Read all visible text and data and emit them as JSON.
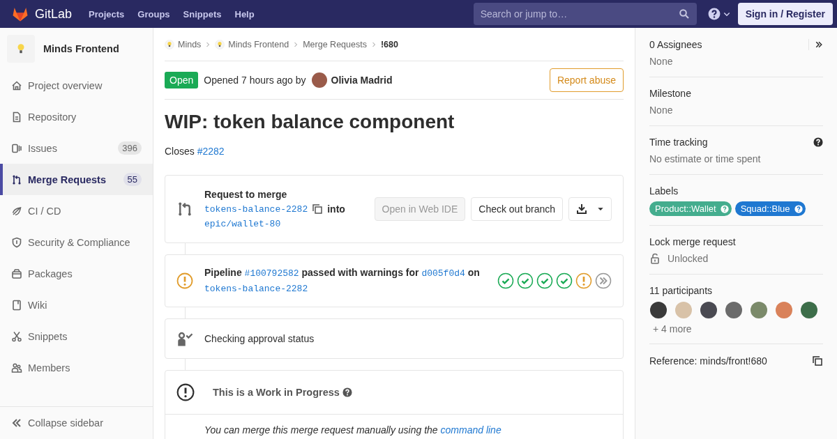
{
  "topbar": {
    "brand": "GitLab",
    "nav": [
      "Projects",
      "Groups",
      "Snippets",
      "Help"
    ],
    "search": {
      "placeholder": "Search or jump to…"
    },
    "sign_in": "Sign in / Register"
  },
  "sidebar": {
    "project": "Minds Frontend",
    "items": [
      {
        "label": "Project overview",
        "selected": false
      },
      {
        "label": "Repository",
        "selected": false
      },
      {
        "label": "Issues",
        "count": "396",
        "selected": false
      },
      {
        "label": "Merge Requests",
        "count": "55",
        "selected": true
      },
      {
        "label": "CI / CD",
        "selected": false
      },
      {
        "label": "Security & Compliance",
        "selected": false
      },
      {
        "label": "Packages",
        "selected": false
      },
      {
        "label": "Wiki",
        "selected": false
      },
      {
        "label": "Snippets",
        "selected": false
      },
      {
        "label": "Members",
        "selected": false
      }
    ],
    "collapse": "Collapse sidebar"
  },
  "breadcrumbs": [
    {
      "label": "Minds",
      "kind": "group"
    },
    {
      "label": "Minds Frontend",
      "kind": "group"
    },
    {
      "label": "Merge Requests",
      "kind": "link"
    },
    {
      "label": "!680",
      "kind": "current"
    }
  ],
  "header": {
    "status": "Open",
    "opened": "Opened 7 hours ago by",
    "author": "Olivia Madrid",
    "report": "Report abuse"
  },
  "title": "WIP: token balance component",
  "description": {
    "text": "Closes",
    "link": "#2282"
  },
  "merge_widget": {
    "heading": "Request to merge",
    "source": "tokens-balance-2282",
    "into": "into",
    "target": "epic/wallet-80",
    "buttons": [
      {
        "label": "Open in Web IDE",
        "disabled": true
      },
      {
        "label": "Check out branch",
        "disabled": false
      }
    ]
  },
  "pipeline": {
    "prefix": "Pipeline",
    "id": "#100792582",
    "status_text": "passed with warnings for",
    "commit": "d005f0d4",
    "on": "on",
    "branch": "tokens-balance-2282",
    "stages": [
      {
        "kind": "success"
      },
      {
        "kind": "success"
      },
      {
        "kind": "success"
      },
      {
        "kind": "success"
      },
      {
        "kind": "warning"
      }
    ]
  },
  "approval": "Checking approval status",
  "wip": {
    "heading": "This is a Work in Progress",
    "text": "You can merge this merge request manually using the",
    "link": "command line"
  },
  "right_sidebar": {
    "assignees": {
      "title": "0 Assignees",
      "value": "None"
    },
    "milestone": {
      "title": "Milestone",
      "value": "None"
    },
    "time_tracking": {
      "title": "Time tracking",
      "value": "No estimate or time spent"
    },
    "labels": {
      "title": "Labels",
      "items": [
        {
          "label": "Product::Wallet",
          "color": "#44ad8e"
        },
        {
          "label": "Squad::Blue",
          "color": "#1f78d1"
        }
      ]
    },
    "lock": {
      "title": "Lock merge request",
      "value": "Unlocked"
    },
    "participants": {
      "title": "11 participants",
      "avatars": [
        {
          "color": "#3a3a3a"
        },
        {
          "color": "#d8c2a8"
        },
        {
          "color": "#4a4a52"
        },
        {
          "color": "#6b6b6b"
        },
        {
          "color": "#7b8a6a"
        },
        {
          "color": "#d9825a"
        },
        {
          "color": "#3d6e4a"
        }
      ],
      "more": "+ 4 more"
    },
    "reference": "Reference: minds/front!680"
  }
}
